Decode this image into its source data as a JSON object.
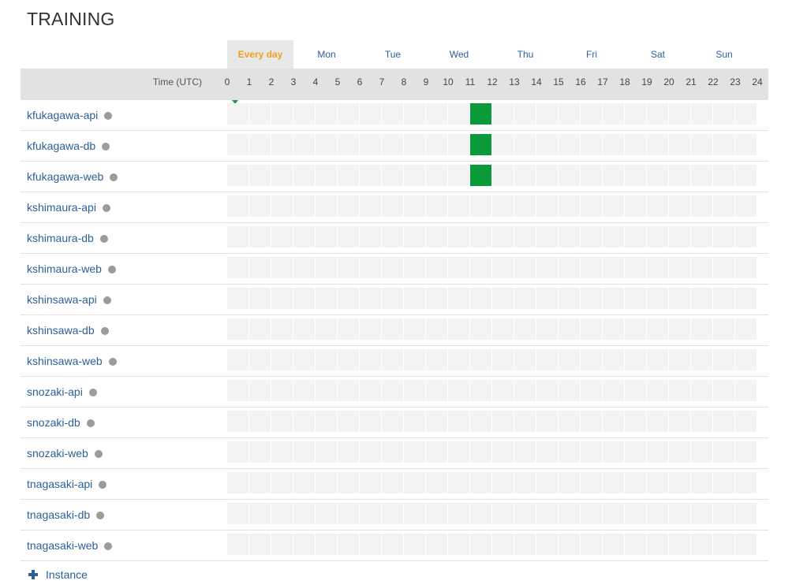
{
  "page": {
    "title": "TRAINING"
  },
  "days": [
    "Every day",
    "Mon",
    "Tue",
    "Wed",
    "Thu",
    "Fri",
    "Sat",
    "Sun"
  ],
  "active_day": "Every day",
  "time_label": "Time (UTC)",
  "hours": [
    "0",
    "1",
    "2",
    "3",
    "4",
    "5",
    "6",
    "7",
    "8",
    "9",
    "10",
    "11",
    "12",
    "13",
    "14",
    "15",
    "16",
    "17",
    "18",
    "19",
    "20",
    "21",
    "22",
    "23",
    "24"
  ],
  "current_hour": 0,
  "colors": {
    "link": "#2d5f99",
    "active_tab": "#f0a020",
    "scheduled": "#0a9a3a",
    "status_dot": "#9b9b9b",
    "empty_cell": "#f3f3f3"
  },
  "instances": [
    {
      "name": "kfukagawa-api",
      "scheduled_hours": [
        11
      ]
    },
    {
      "name": "kfukagawa-db",
      "scheduled_hours": [
        11
      ]
    },
    {
      "name": "kfukagawa-web",
      "scheduled_hours": [
        11
      ]
    },
    {
      "name": "kshimaura-api",
      "scheduled_hours": []
    },
    {
      "name": "kshimaura-db",
      "scheduled_hours": []
    },
    {
      "name": "kshimaura-web",
      "scheduled_hours": []
    },
    {
      "name": "kshinsawa-api",
      "scheduled_hours": []
    },
    {
      "name": "kshinsawa-db",
      "scheduled_hours": []
    },
    {
      "name": "kshinsawa-web",
      "scheduled_hours": []
    },
    {
      "name": "snozaki-api",
      "scheduled_hours": []
    },
    {
      "name": "snozaki-db",
      "scheduled_hours": []
    },
    {
      "name": "snozaki-web",
      "scheduled_hours": []
    },
    {
      "name": "tnagasaki-api",
      "scheduled_hours": []
    },
    {
      "name": "tnagasaki-db",
      "scheduled_hours": []
    },
    {
      "name": "tnagasaki-web",
      "scheduled_hours": []
    }
  ],
  "add_button": {
    "icon": "plus-icon",
    "label": "Instance"
  }
}
